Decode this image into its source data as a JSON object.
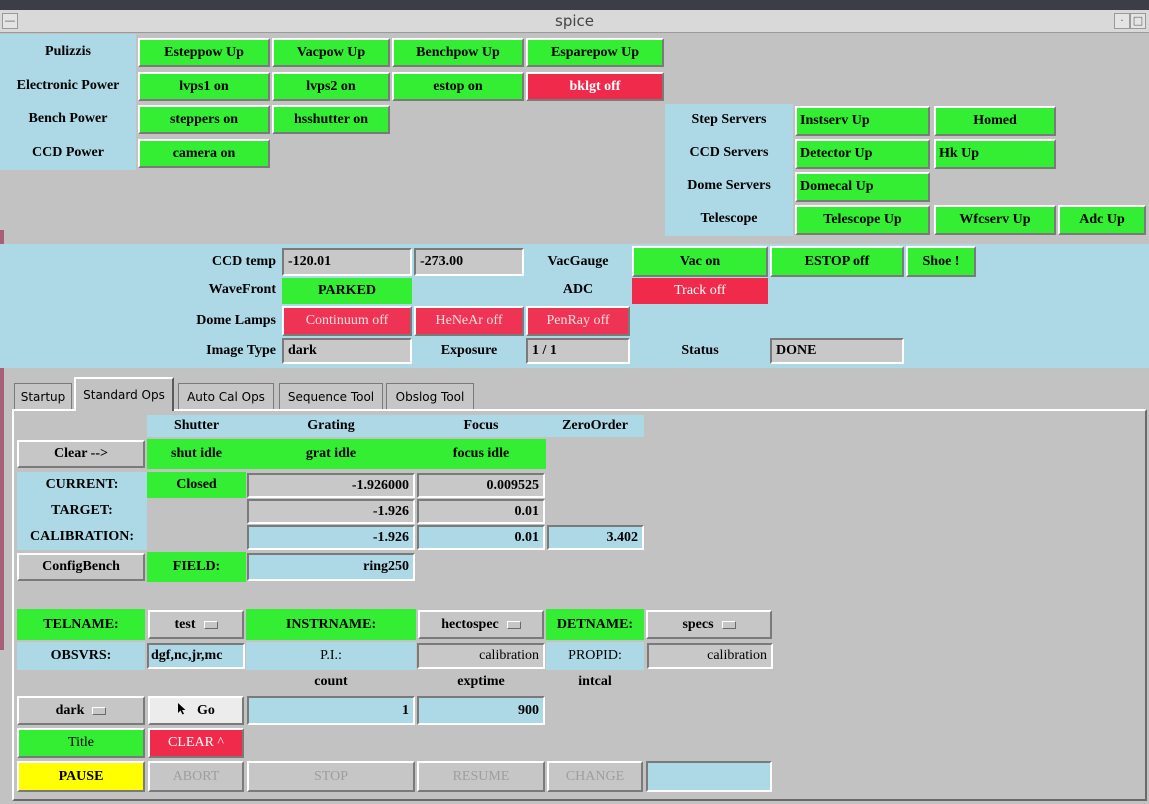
{
  "window": {
    "title": "spice"
  },
  "status_grid": {
    "row_labels": [
      "Pulizzis",
      "Electronic Power",
      "Bench Power",
      "CCD Power"
    ],
    "pulizzis": [
      "Esteppow Up",
      "Vacpow Up",
      "Benchpow Up",
      "Esparepow Up"
    ],
    "electronic_power": [
      "lvps1  on",
      "lvps2  on",
      "estop  on",
      "bklgt  off"
    ],
    "bench_power": [
      "steppers  on",
      "hsshutter  on"
    ],
    "ccd_power": [
      "camera  on"
    ]
  },
  "servers": {
    "labels": [
      "Step Servers",
      "CCD Servers",
      "Dome Servers",
      "Telescope"
    ],
    "step": [
      "Instserv Up",
      "Homed"
    ],
    "ccd": [
      "Detector Up",
      "Hk Up"
    ],
    "dome": [
      "Domecal Up"
    ],
    "telescope": [
      "Telescope Up",
      "Wfcserv Up",
      "Adc Up"
    ]
  },
  "status_panel": {
    "ccd_temp_label": "CCD temp",
    "ccd_temp_1": "-120.01",
    "ccd_temp_2": "-273.00",
    "vacgauge_label": "VacGauge",
    "vac_button": "Vac on",
    "estop_button": "ESTOP off",
    "shoe_button": "Shoe !",
    "wavefront_label": "WaveFront",
    "wavefront_button": "PARKED",
    "adc_label": "ADC",
    "adc_button": "Track  off",
    "dome_lamps_label": "Dome Lamps",
    "lamps": [
      "Continuum off",
      "HeNeAr off",
      "PenRay off"
    ],
    "image_type_label": "Image Type",
    "image_type_value": "dark",
    "exposure_label": "Exposure",
    "exposure_value": "1 / 1",
    "status_label": "Status",
    "status_value": "DONE"
  },
  "tabs": [
    "Startup",
    "Standard Ops",
    "Auto Cal Ops",
    "Sequence Tool",
    "Obslog Tool"
  ],
  "standard_ops": {
    "headers": [
      "Shutter",
      "Grating",
      "Focus",
      "ZeroOrder"
    ],
    "clear_button": "Clear -->",
    "shutter_state": "shut idle",
    "grating_state": "grat idle",
    "focus_state": "focus idle",
    "current_label": "CURRENT:",
    "shutter_current": "Closed",
    "grating_current": "-1.926000",
    "focus_current": "0.009525",
    "target_label": "TARGET:",
    "grating_target": "-1.926",
    "focus_target": "0.01",
    "calibration_label": "CALIBRATION:",
    "grating_cal": "-1.926",
    "focus_cal": "0.01",
    "zeroorder_cal": "3.402",
    "configbench_button": "ConfigBench",
    "field_label": "FIELD:",
    "field_value": "ring250",
    "telname_label": "TELNAME:",
    "telname_value": "test",
    "instrname_label": "INSTRNAME:",
    "instrname_value": "hectospec",
    "detname_label": "DETNAME:",
    "detname_value": "specs",
    "obsvrs_label": "OBSVRS:",
    "obsvrs_value": "dgf,nc,jr,mc",
    "pi_label": "P.I.:",
    "pi_value": "calibration",
    "propid_label": "PROPID:",
    "propid_value": "calibration",
    "count_label": "count",
    "exptime_label": "exptime",
    "intcal_label": "intcal",
    "imagetype_select": "dark",
    "go_button": "Go",
    "count_value": "1",
    "exptime_value": "900",
    "title_button": "Title",
    "clear_title_button": "CLEAR ^",
    "pause_button": "PAUSE",
    "abort_button": "ABORT",
    "stop_button": "STOP",
    "resume_button": "RESUME",
    "change_button": "CHANGE"
  }
}
